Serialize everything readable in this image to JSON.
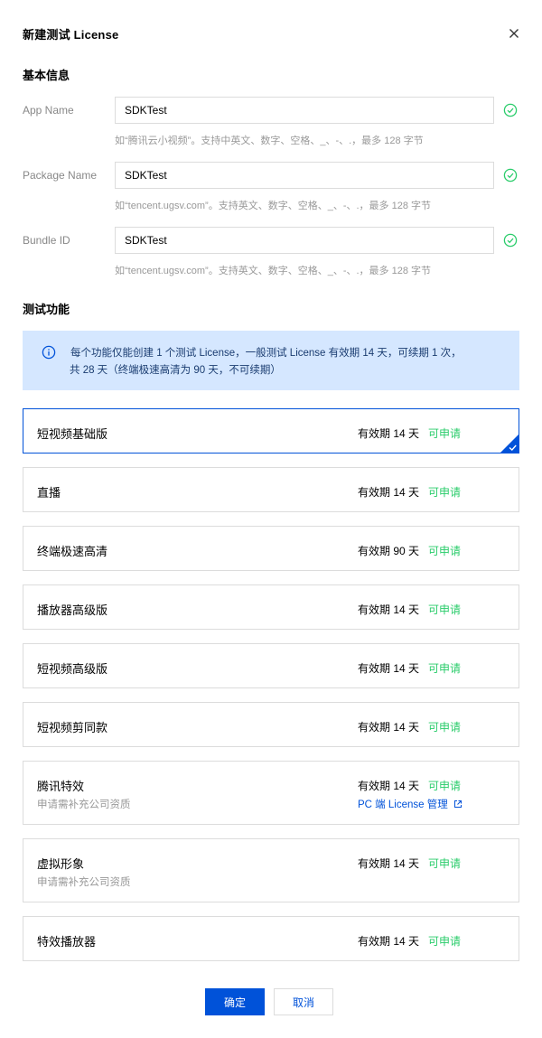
{
  "dialog": {
    "title": "新建测试 License"
  },
  "basic": {
    "section_title": "基本信息",
    "fields": [
      {
        "label": "App Name",
        "value": "SDKTest",
        "hint": "如“腾讯云小视频”。支持中英文、数字、空格、_、-、.，最多 128 字节"
      },
      {
        "label": "Package Name",
        "value": "SDKTest",
        "hint": "如“tencent.ugsv.com”。支持英文、数字、空格、_、-、.，最多 128 字节"
      },
      {
        "label": "Bundle ID",
        "value": "SDKTest",
        "hint": "如“tencent.ugsv.com”。支持英文、数字、空格、_、-、.，最多 128 字节"
      }
    ]
  },
  "features": {
    "section_title": "测试功能",
    "notice": {
      "line1": "每个功能仅能创建 1 个测试 License，一般测试 License 有效期 14 天，可续期 1 次，",
      "line2": "共 28 天（终端极速高清为 90 天，不可续期）"
    },
    "items": [
      {
        "name": "短视频基础版",
        "validity": "有效期 14 天",
        "status": "可申请",
        "selected": true
      },
      {
        "name": "直播",
        "validity": "有效期 14 天",
        "status": "可申请"
      },
      {
        "name": "终端极速高清",
        "validity": "有效期 90 天",
        "status": "可申请"
      },
      {
        "name": "播放器高级版",
        "validity": "有效期 14 天",
        "status": "可申请"
      },
      {
        "name": "短视频高级版",
        "validity": "有效期 14 天",
        "status": "可申请"
      },
      {
        "name": "短视频剪同款",
        "validity": "有效期 14 天",
        "status": "可申请"
      },
      {
        "name": "腾讯特效",
        "sub": "申请需补充公司资质",
        "validity": "有效期 14 天",
        "status": "可申请",
        "link": "PC 端 License 管理"
      },
      {
        "name": "虚拟形象",
        "sub": "申请需补充公司资质",
        "validity": "有效期 14 天",
        "status": "可申请"
      },
      {
        "name": "特效播放器",
        "validity": "有效期 14 天",
        "status": "可申请"
      }
    ]
  },
  "footer": {
    "confirm_label": "确定",
    "cancel_label": "取消"
  },
  "colors": {
    "primary": "#0052d9",
    "success": "#29cc6a",
    "notice_bg": "#d5e7ff"
  }
}
